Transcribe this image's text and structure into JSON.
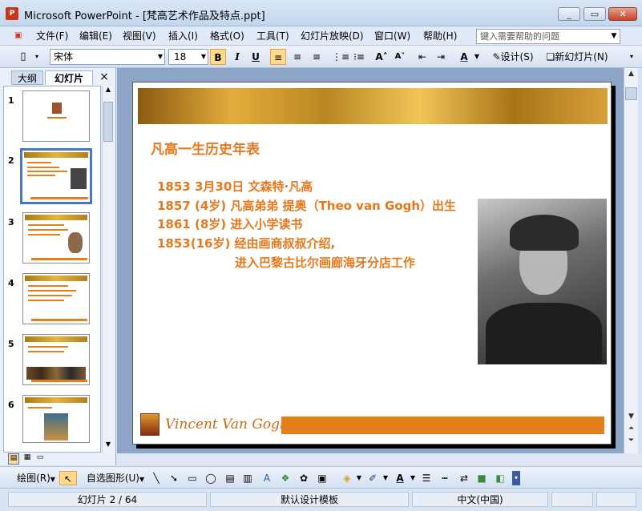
{
  "window": {
    "icon": "P",
    "title": "Microsoft PowerPoint - [梵高艺术作品及特点.ppt]",
    "minimize": "_",
    "restore": "▭",
    "close": "✕"
  },
  "menu": {
    "items": [
      "文件(F)",
      "编辑(E)",
      "视图(V)",
      "插入(I)",
      "格式(O)",
      "工具(T)",
      "幻灯片放映(D)",
      "窗口(W)",
      "帮助(H)"
    ],
    "help_placeholder": "键入需要帮助的问题"
  },
  "toolbar": {
    "font_name": "宋体",
    "font_size": "18",
    "bold": "B",
    "italic": "I",
    "underline": "U",
    "design_label": "设计(S)",
    "new_slide_label": "新幻灯片(N)"
  },
  "panel": {
    "tab_outline": "大纲",
    "tab_slides": "幻灯片",
    "close": "×",
    "slide_numbers": [
      "1",
      "2",
      "3",
      "4",
      "5",
      "6"
    ],
    "selected_slide": "2"
  },
  "slide": {
    "title": "凡高一生历史年表",
    "timeline": [
      "1853  3月30日 文森特·凡高",
      "1857 (4岁)  凡高弟弟 提奥（Theo van Gogh）出生",
      "1861 (8岁)  进入小学读书",
      "1853(16岁)  经由画商叔叔介绍,",
      "进入巴黎古比尔画廊海牙分店工作"
    ],
    "footer_signature": "Vincent Van Gogh"
  },
  "drawing_toolbar": {
    "draw_label": "绘图(R)",
    "autoshapes_label": "自选图形(U)"
  },
  "status": {
    "slide_position": "幻灯片 2 / 64",
    "template": "默认设计模板",
    "language": "中文(中国)"
  },
  "colors": {
    "accent": "#e6781c",
    "selection": "#4a78c0"
  }
}
